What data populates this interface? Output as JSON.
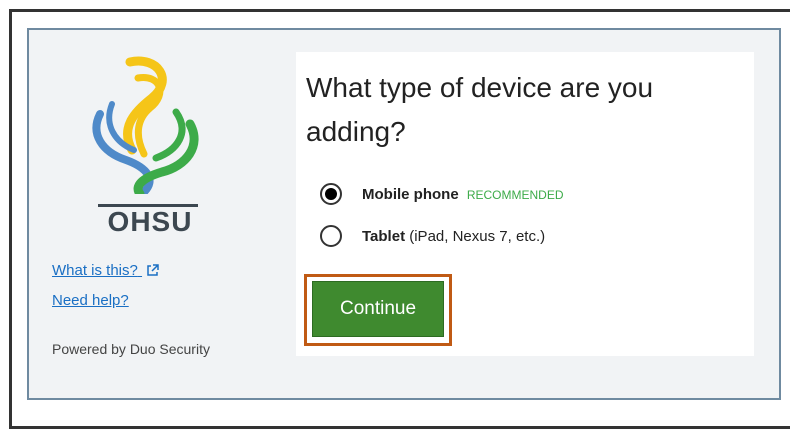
{
  "sidebar": {
    "brand": "OHSU",
    "what_is_this": "What is this?",
    "need_help": "Need help?",
    "powered_by": "Powered by Duo Security"
  },
  "main": {
    "question": "What type of device are you adding?",
    "options": [
      {
        "label": "Mobile phone",
        "badge": "RECOMMENDED",
        "detail": "",
        "checked": true
      },
      {
        "label": "Tablet",
        "badge": "",
        "detail": "(iPad, Nexus 7, etc.)",
        "checked": false
      }
    ],
    "continue_label": "Continue"
  },
  "colors": {
    "accent_green": "#3f8a2f",
    "recommended_green": "#3dab49",
    "highlight_orange": "#c05a14",
    "link_blue": "#1a6fc4"
  },
  "icons": [
    "external-link-icon",
    "ohsu-logo-icon",
    "radio-checked-icon",
    "radio-unchecked-icon"
  ]
}
